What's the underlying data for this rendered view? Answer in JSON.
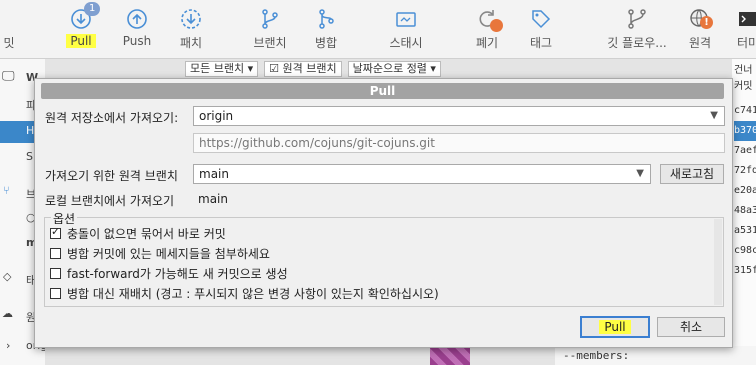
{
  "toolbar": {
    "items": [
      {
        "label": "밋",
        "icon": "commit-icon"
      },
      {
        "label": "Pull",
        "icon": "pull-icon",
        "badge": "1"
      },
      {
        "label": "Push",
        "icon": "push-icon"
      },
      {
        "label": "패치",
        "icon": "fetch-icon"
      },
      {
        "label": "브랜치",
        "icon": "branch-icon"
      },
      {
        "label": "병합",
        "icon": "merge-icon"
      },
      {
        "label": "스태시",
        "icon": "stash-icon"
      },
      {
        "label": "폐기",
        "icon": "discard-icon"
      },
      {
        "label": "태그",
        "icon": "tag-icon"
      },
      {
        "label": "깃 플로우...",
        "icon": "git-flow-icon"
      },
      {
        "label": "원격",
        "icon": "remote-icon",
        "badge": "!"
      },
      {
        "label": "터미",
        "icon": "terminal-icon"
      }
    ]
  },
  "background": {
    "filter_branches": "모든 브랜치 ▾",
    "filter_remote": "☑ 원격 브랜치",
    "filter_sort": "날짜순으로 정렬 ▾",
    "sidebar_labels": [
      "W",
      "파",
      "H",
      "S",
      "브",
      "○",
      "m",
      "태",
      "원",
      "origin"
    ],
    "hash_labels": [
      "건너",
      "커밋",
      "c741",
      "b370",
      "7aef",
      "72fd",
      "e20a",
      "48a3",
      "a531",
      "c98c",
      "315f"
    ],
    "code_line": "--members:"
  },
  "dialog": {
    "title": "Pull",
    "remote_repo_label": "원격 저장소에서 가져오기:",
    "remote_repo_value": "origin",
    "remote_url": "https://github.com/cojuns/git-cojuns.git",
    "remote_branch_label": "가져오기 위한 원격 브랜치",
    "remote_branch_value": "main",
    "refresh_button": "새로고침",
    "local_branch_label": "로컬 브랜치에서 가져오기",
    "local_branch_value": "main",
    "options_title": "옵션",
    "options": [
      {
        "label": "충돌이 없으면 묶어서 바로 커밋",
        "checked": true
      },
      {
        "label": "병합 커밋에 있는 메세지들을 첨부하세요",
        "checked": false
      },
      {
        "label": "fast-forward가 가능해도 새 커밋으로 생성",
        "checked": false
      },
      {
        "label": "병합 대신 재배치 (경고 : 푸시되지 않은 변경 사항이 있는지 확인하십시오)",
        "checked": false
      }
    ],
    "pull_button": "Pull",
    "cancel_button": "취소"
  },
  "colors": {
    "highlight": "#ffff44",
    "selection": "#3b87c9",
    "warning_badge": "#e8763c"
  }
}
